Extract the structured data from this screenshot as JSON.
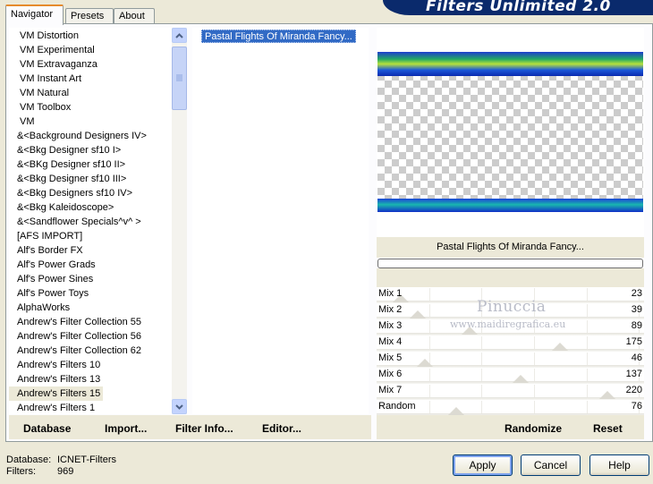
{
  "tabs": [
    {
      "label": "Navigator",
      "active": true
    },
    {
      "label": "Presets",
      "active": false
    },
    {
      "label": "About",
      "active": false
    }
  ],
  "app_title": "Filters Unlimited 2.0",
  "categories": [
    {
      "label": "VM Distortion",
      "selected": false
    },
    {
      "label": "VM Experimental",
      "selected": false
    },
    {
      "label": "VM Extravaganza",
      "selected": false
    },
    {
      "label": "VM Instant Art",
      "selected": false
    },
    {
      "label": "VM Natural",
      "selected": false
    },
    {
      "label": "VM Toolbox",
      "selected": false
    },
    {
      "label": "VM",
      "selected": false
    },
    {
      "label": "&<Background Designers IV>",
      "selected": false
    },
    {
      "label": "&<Bkg Designer sf10 I>",
      "selected": false
    },
    {
      "label": "&<BKg Designer sf10 II>",
      "selected": false
    },
    {
      "label": "&<Bkg Designer sf10 III>",
      "selected": false
    },
    {
      "label": "&<Bkg Designers sf10 IV>",
      "selected": false
    },
    {
      "label": "&<Bkg Kaleidoscope>",
      "selected": false
    },
    {
      "label": "&<Sandflower Specials^v^ >",
      "selected": false
    },
    {
      "label": "[AFS IMPORT]",
      "selected": false
    },
    {
      "label": "Alf's Border FX",
      "selected": false
    },
    {
      "label": "Alf's Power Grads",
      "selected": false
    },
    {
      "label": "Alf's Power Sines",
      "selected": false
    },
    {
      "label": "Alf's Power Toys",
      "selected": false
    },
    {
      "label": "AlphaWorks",
      "selected": false
    },
    {
      "label": "Andrew's Filter Collection 55",
      "selected": false
    },
    {
      "label": "Andrew's Filter Collection 56",
      "selected": false
    },
    {
      "label": "Andrew's Filter Collection 62",
      "selected": false
    },
    {
      "label": "Andrew's Filters 10",
      "selected": false
    },
    {
      "label": "Andrew's Filters 13",
      "selected": false
    },
    {
      "label": "Andrew's Filters 15",
      "selected": true
    },
    {
      "label": "Andrew's Filters 1",
      "selected": false
    }
  ],
  "filters": [
    {
      "label": "Pastal Flights Of Miranda Fancy...",
      "selected": true
    }
  ],
  "preview": {
    "filter_name": "Pastal Flights Of Miranda Fancy...",
    "progress_percent": 0
  },
  "sliders": [
    {
      "label": "Mix 1",
      "value": 23
    },
    {
      "label": "Mix 2",
      "value": 39
    },
    {
      "label": "Mix 3",
      "value": 89
    },
    {
      "label": "Mix 4",
      "value": 175
    },
    {
      "label": "Mix 5",
      "value": 46
    },
    {
      "label": "Mix 6",
      "value": 137
    },
    {
      "label": "Mix 7",
      "value": 220
    },
    {
      "label": "Random",
      "value": 76
    }
  ],
  "slider_max": 255,
  "watermark": {
    "name": "Pinuccia",
    "url": "www.maidiregrafica.eu"
  },
  "actions": {
    "database": "Database",
    "import": "Import...",
    "filter_info": "Filter Info...",
    "editor": "Editor...",
    "randomize": "Randomize",
    "reset": "Reset"
  },
  "status": {
    "database_label": "Database:",
    "database_value": "ICNET-Filters",
    "filters_label": "Filters:",
    "filters_value": "969"
  },
  "buttons": {
    "apply": "Apply",
    "cancel": "Cancel",
    "help": "Help"
  },
  "colors": {
    "selection": "#316ac5",
    "banner": "#0a2a6c",
    "dialog_bg": "#ece9d8"
  }
}
